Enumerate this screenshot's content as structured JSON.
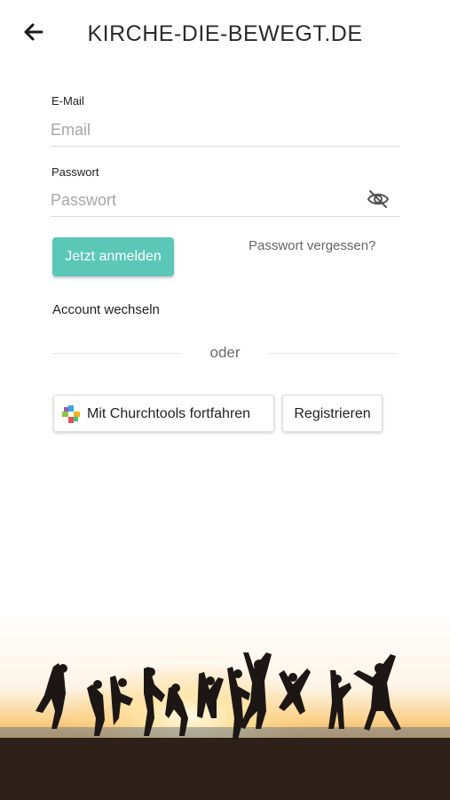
{
  "header": {
    "title": "KIRCHE-DIE-BEWEGT.DE",
    "back_icon": "arrow-left-icon"
  },
  "form": {
    "email": {
      "label": "E-Mail",
      "placeholder": "Email",
      "value": ""
    },
    "password": {
      "label": "Passwort",
      "placeholder": "Passwort",
      "value": "",
      "toggle_icon": "eye-off-icon"
    },
    "login_button": "Jetzt anmelden",
    "forgot_link": "Passwort vergessen?",
    "switch_account": "Account wechseln"
  },
  "divider": {
    "text": "oder"
  },
  "alt_login": {
    "churchtools_button": "Mit Churchtools fortfahren",
    "churchtools_icon": "churchtools-logo-icon",
    "register_button": "Registrieren"
  },
  "colors": {
    "accent": "#5ac7b7"
  }
}
